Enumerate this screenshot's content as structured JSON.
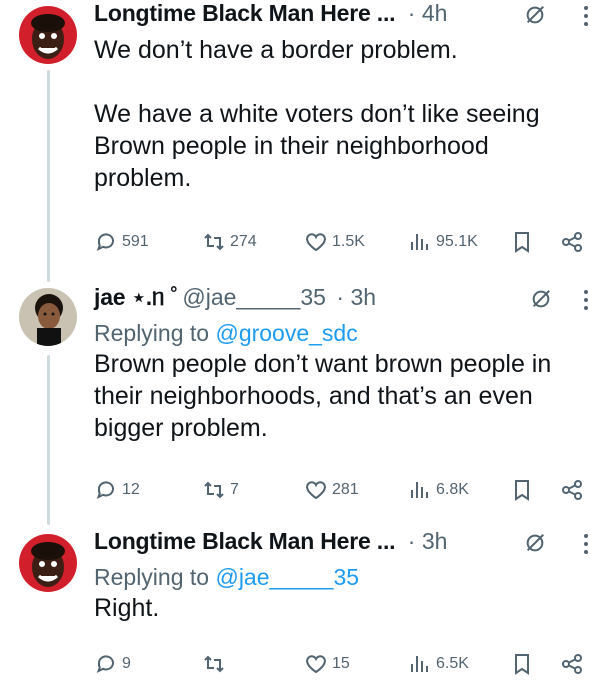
{
  "posts": [
    {
      "author": "Longtime Black Man Here ...",
      "time": "· 4h",
      "replying_label": "",
      "replying_to": "",
      "text": "We don’t have a border problem.\n\nWe have a white voters don’t like seeing Brown people in their neighborhood problem.",
      "stats": {
        "replies": "591",
        "reposts": "274",
        "likes": "1.5K",
        "views": "95.1K"
      }
    },
    {
      "author": "jae ⋆.ᥒ ˚",
      "handle": "@jae_____35",
      "time": "· 3h",
      "replying_label": "Replying to",
      "replying_to": "@groove_sdc",
      "text": "Brown people don’t want brown people in their neighborhoods, and that’s an even bigger problem.",
      "stats": {
        "replies": "12",
        "reposts": "7",
        "likes": "281",
        "views": "6.8K"
      }
    },
    {
      "author": "Longtime Black Man Here ...",
      "time": "· 3h",
      "replying_label": "Replying to",
      "replying_to": "@jae_____35",
      "text": "Right.",
      "stats": {
        "replies": "9",
        "reposts": "",
        "likes": "15",
        "views": "6.5K"
      }
    }
  ],
  "icons": [
    "reply-icon",
    "repost-icon",
    "like-icon",
    "views-icon",
    "bookmark-icon",
    "share-icon",
    "grok-icon",
    "more-icon"
  ],
  "colors": {
    "text": "#0f1419",
    "muted": "#536471",
    "link": "#1d9bf0",
    "thread_line": "#cfd9de"
  }
}
